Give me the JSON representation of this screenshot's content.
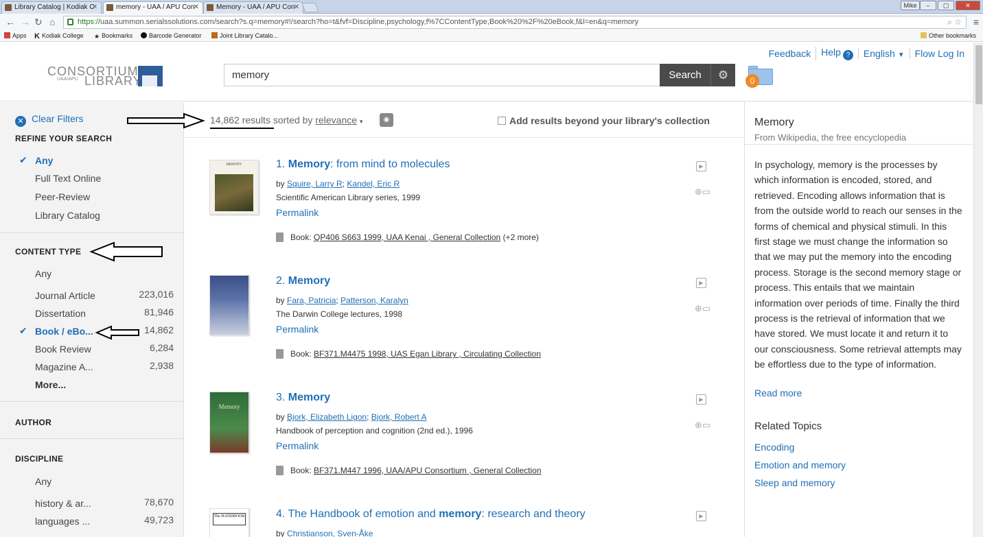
{
  "browser": {
    "tabs": [
      {
        "label": "Library Catalog | Kodiak C",
        "active": false
      },
      {
        "label": "memory - UAA / APU Con",
        "active": true
      },
      {
        "label": "Memory - UAA / APU Con",
        "active": false
      }
    ],
    "user": "Mike",
    "url_scheme": "https://",
    "url_rest": "uaa.summon.serialssolutions.com/search?s.q=memory#!/search?ho=t&fvf=Discipline,psychology,f%7CContentType,Book%20%2F%20eBook,f&l=en&q=memory",
    "bookmarks": [
      {
        "label": "Apps",
        "icon": "apps-grid-icon"
      },
      {
        "label": "Kodiak College",
        "icon": "k-logo-icon"
      },
      {
        "label": "Bookmarks",
        "icon": "star-icon"
      },
      {
        "label": "Barcode Generator",
        "icon": "barcode-icon"
      },
      {
        "label": "Joint Library Catalo...",
        "icon": "library-icon"
      }
    ],
    "other_bookmarks": "Other bookmarks"
  },
  "header": {
    "logo_line1": "CONSORTIUM",
    "logo_line2": "UAA/APU",
    "logo_line3": "LIBRARY",
    "search_value": "memory",
    "search_button": "Search",
    "saved_count": "0",
    "links": {
      "feedback": "Feedback",
      "help": "Help",
      "language": "English",
      "login": "Flow Log In"
    }
  },
  "sidebar": {
    "clear_filters": "Clear Filters",
    "refine_heading": "REFINE YOUR SEARCH",
    "refine_items": [
      "Any",
      "Full Text Online",
      "Peer-Review",
      "Library Catalog"
    ],
    "content_type_heading": "CONTENT TYPE",
    "content_type_items": [
      {
        "label": "Any",
        "count": ""
      },
      {
        "label": "Journal Article",
        "count": "223,016"
      },
      {
        "label": "Dissertation",
        "count": "81,946"
      },
      {
        "label": "Book / eBo...",
        "count": "14,862"
      },
      {
        "label": "Book Review",
        "count": "6,284"
      },
      {
        "label": "Magazine A...",
        "count": "2,938"
      }
    ],
    "more": "More...",
    "author_heading": "AUTHOR",
    "discipline_heading": "DISCIPLINE",
    "discipline_items": [
      {
        "label": "Any",
        "count": ""
      },
      {
        "label": "history & ar...",
        "count": "78,670"
      },
      {
        "label": "languages ...",
        "count": "49,723"
      }
    ]
  },
  "results_bar": {
    "count": "14,862 results",
    "sorted_by": "sorted by",
    "sort": "relevance",
    "beyond": "Add results beyond your library's collection"
  },
  "results": [
    {
      "num": "1.",
      "title_bold": "Memory",
      "title_rest": ": from mind to molecules",
      "by": "by",
      "authors": [
        "Squire, Larry R",
        "Kandel, Eric R"
      ],
      "pub": "Scientific American Library series, 1999",
      "permalink": "Permalink",
      "book_prefix": "Book:",
      "holding": "QP406 S663 1999, UAA Kenai , General Collection",
      "more": "(+2 more)"
    },
    {
      "num": "2.",
      "title_bold": "Memory",
      "title_rest": "",
      "by": "by",
      "authors": [
        "Fara, Patricia",
        "Patterson, Karalyn"
      ],
      "pub": "The Darwin College lectures, 1998",
      "permalink": "Permalink",
      "book_prefix": "Book:",
      "holding": "BF371.M4475 1998, UAS Egan Library , Circulating Collection",
      "more": ""
    },
    {
      "num": "3.",
      "title_bold": "Memory",
      "title_rest": "",
      "by": "by",
      "authors": [
        "Bjork, Elizabeth Ligon",
        "Bjork, Robert A"
      ],
      "pub": "Handbook of perception and cognition (2nd ed.), 1996",
      "permalink": "Permalink",
      "book_prefix": "Book:",
      "holding": "BF371.M447 1996, UAA/APU Consortium , General Collection",
      "more": ""
    },
    {
      "num": "4.",
      "title_pre": "The Handbook of emotion and ",
      "title_bold": "memory",
      "title_rest": ": research and theory",
      "by": "by",
      "authors": [
        "Christianson, Sven-Åke"
      ]
    }
  ],
  "thumbs": {
    "t1": "MEMORY",
    "t3": "Memory",
    "t4": "The HANDBOOK"
  },
  "right_panel": {
    "title": "Memory",
    "subtitle": "From Wikipedia, the free encyclopedia",
    "body": "In psychology, memory is the processes by which information is encoded, stored, and retrieved. Encoding allows information that is from the outside world to reach our senses in the forms of chemical and physical stimuli. In this first stage we must change the information so that we may put the memory into the encoding process. Storage is the second memory stage or process. This entails that we maintain information over periods of time. Finally the third process is the retrieval of information that we have stored. We must locate it and return it to our consciousness. Some retrieval attempts may be effortless due to the type of information.",
    "read_more": "Read more",
    "related_heading": "Related Topics",
    "topics": [
      "Encoding",
      "Emotion and memory",
      "Sleep and memory"
    ]
  },
  "colors": {
    "link": "#1f6fb5",
    "accent_orange": "#f08a24",
    "search_button": "#4a4a4a"
  }
}
